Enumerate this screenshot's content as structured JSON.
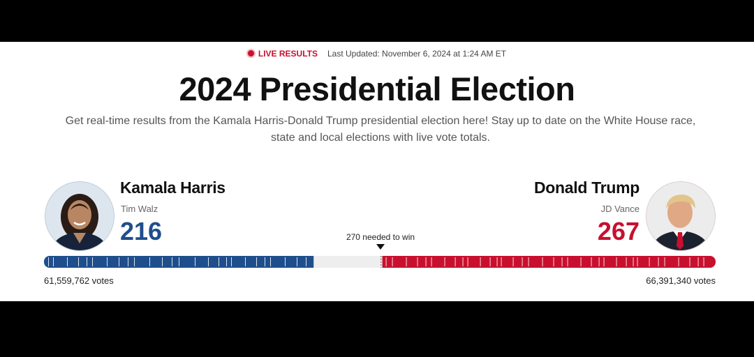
{
  "header": {
    "live_label": "LIVE RESULTS",
    "last_updated": "Last Updated: November 6, 2024 at 1:24 AM ET"
  },
  "title": "2024 Presidential Election",
  "subtitle_line1": "Get real-time results from the Kamala Harris-Donald Trump presidential election here! Stay up to date on the White House race,",
  "subtitle_line2": "state and local elections with live vote totals.",
  "threshold_label": "270 needed to win",
  "candidates": {
    "harris": {
      "name": "Kamala Harris",
      "running_mate": "Tim Walz",
      "electoral_votes": "216",
      "popular_votes": "61,559,762 votes",
      "color": "#1f4e8c"
    },
    "trump": {
      "name": "Donald Trump",
      "running_mate": "JD Vance",
      "electoral_votes": "267",
      "popular_votes": "66,391,340 votes",
      "color": "#c8102e"
    }
  },
  "electoral_bar": {
    "total": 538,
    "threshold": 270,
    "dem": 216,
    "rep": 267,
    "uncalled_color": "#eeeeee"
  }
}
